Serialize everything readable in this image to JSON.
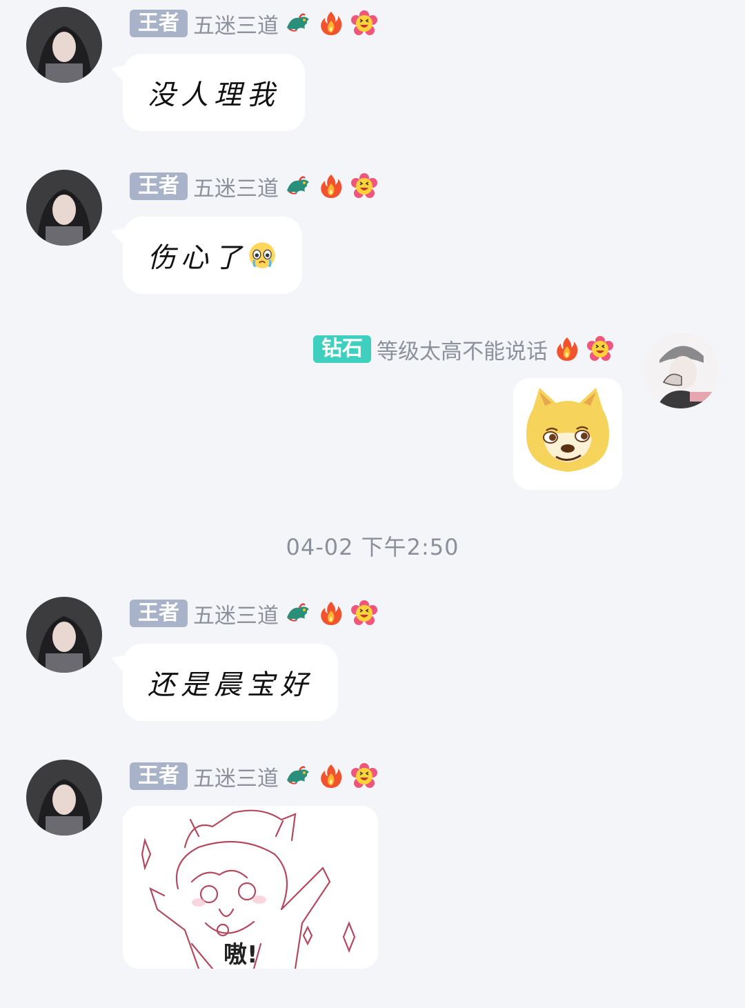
{
  "colors": {
    "background": "#f3f5f9",
    "bubble": "#ffffff",
    "king_badge": "#a8b2c8",
    "diamond_badge": "#3fcfbf",
    "nickname": "#8c919b"
  },
  "messages": [
    {
      "badge": "王者",
      "nickname": "五迷三道",
      "icons": [
        "dragon-icon",
        "fire-icon",
        "flower-smile-icon"
      ],
      "text": "没人理我"
    },
    {
      "badge": "王者",
      "nickname": "五迷三道",
      "icons": [
        "dragon-icon",
        "fire-icon",
        "flower-smile-icon"
      ],
      "text": "伤心了",
      "trailing_icon": "crying-face-icon"
    },
    {
      "badge": "钻石",
      "nickname": "等级太高不能说话",
      "icons": [
        "fire-icon",
        "flower-smile-icon"
      ],
      "sticker": "doge-sticker"
    },
    {
      "badge": "王者",
      "nickname": "五迷三道",
      "icons": [
        "dragon-icon",
        "fire-icon",
        "flower-smile-icon"
      ],
      "text": "还是晨宝好"
    },
    {
      "badge": "王者",
      "nickname": "五迷三道",
      "icons": [
        "dragon-icon",
        "fire-icon",
        "flower-smile-icon"
      ],
      "sticker": "cat-girl-sketch-sticker",
      "sticker_caption": "嗷!"
    }
  ],
  "timestamp": "04-02 下午2:50"
}
